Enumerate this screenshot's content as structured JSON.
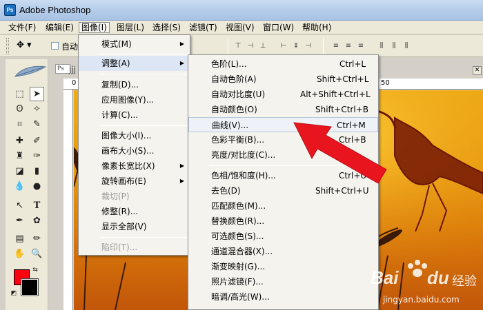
{
  "window": {
    "title": "Adobe Photoshop"
  },
  "menubar": {
    "items": [
      {
        "label": "文件(F)"
      },
      {
        "label": "编辑(E)"
      },
      {
        "label": "图像(I)"
      },
      {
        "label": "图层(L)"
      },
      {
        "label": "选择(S)"
      },
      {
        "label": "滤镜(T)"
      },
      {
        "label": "视图(V)"
      },
      {
        "label": "窗口(W)"
      },
      {
        "label": "帮助(H)"
      }
    ]
  },
  "optionsbar": {
    "auto_label": "自动"
  },
  "document": {
    "title": "jjj"
  },
  "rulers": {
    "top_labels": [
      "0",
      "50"
    ]
  },
  "image_menu": {
    "items": [
      {
        "label": "模式(M)",
        "submenu": true
      },
      {
        "label": "调整(A)",
        "submenu": true,
        "highlight": true
      },
      {
        "label": "复制(D)..."
      },
      {
        "label": "应用图像(Y)..."
      },
      {
        "label": "计算(C)..."
      },
      {
        "label": "图像大小(I)..."
      },
      {
        "label": "画布大小(S)..."
      },
      {
        "label": "像素长宽比(X)",
        "submenu": true
      },
      {
        "label": "旋转画布(E)",
        "submenu": true
      },
      {
        "label": "裁切(P)",
        "disabled": true
      },
      {
        "label": "修整(R)..."
      },
      {
        "label": "显示全部(V)"
      },
      {
        "label": "陷印(T)...",
        "disabled": true
      }
    ]
  },
  "adjust_menu": {
    "items": [
      {
        "label": "色阶(L)...",
        "shortcut": "Ctrl+L"
      },
      {
        "label": "自动色阶(A)",
        "shortcut": "Shift+Ctrl+L"
      },
      {
        "label": "自动对比度(U)",
        "shortcut": "Alt+Shift+Ctrl+L"
      },
      {
        "label": "自动颜色(O)",
        "shortcut": "Shift+Ctrl+B"
      },
      {
        "label": "曲线(V)...",
        "shortcut": "Ctrl+M",
        "hover": true
      },
      {
        "label": "色彩平衡(B)...",
        "shortcut": "Ctrl+B"
      },
      {
        "label": "亮度/对比度(C)..."
      },
      {
        "label": "色相/饱和度(H)...",
        "shortcut": "Ctrl+U"
      },
      {
        "label": "去色(D)",
        "shortcut": "Shift+Ctrl+U"
      },
      {
        "label": "匹配颜色(M)..."
      },
      {
        "label": "替换颜色(R)..."
      },
      {
        "label": "可选颜色(S)..."
      },
      {
        "label": "通道混合器(X)..."
      },
      {
        "label": "渐变映射(G)..."
      },
      {
        "label": "照片滤镜(F)..."
      },
      {
        "label": "暗调/高光(W)..."
      }
    ]
  },
  "colors": {
    "foreground": "#ff0011",
    "background": "#000000",
    "annotation_arrow": "#e8141e"
  },
  "watermark": {
    "brand": "Bai",
    "brand2": "du",
    "suffix": "经验",
    "url": "jingyan.baidu.com"
  }
}
